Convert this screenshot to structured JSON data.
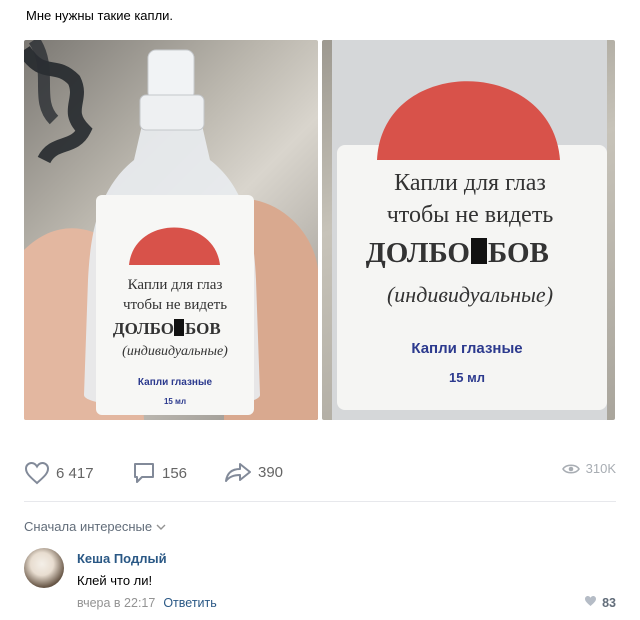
{
  "post": {
    "text": "Мне нужны такие капли.",
    "photos": [
      {
        "name": "photo-hand-bottle",
        "label": {
          "line1": "Капли для глаз",
          "line2": "чтобы не видеть",
          "line3a": "ДОЛБО",
          "line3b": "БОВ",
          "line4": "(индивидуальные)",
          "line5": "Капли глазные",
          "line6": "15 мл"
        }
      },
      {
        "name": "photo-label-closeup",
        "label": {
          "line1": "Капли для глаз",
          "line2": "чтобы не видеть",
          "line3a": "ДОЛБО",
          "line3b": "БОВ",
          "line4": "(индивидуальные)",
          "line5": "Капли глазные",
          "line6": "15 мл"
        }
      }
    ]
  },
  "actions": {
    "likes": "6 417",
    "comments": "156",
    "shares": "390",
    "views": "310K"
  },
  "comments": {
    "sort_label": "Сначала интересные",
    "items": [
      {
        "author": "Кеша Подлый",
        "text": "Клей что ли!",
        "time": "вчера в 22:17",
        "reply_label": "Ответить",
        "likes": "83"
      }
    ]
  },
  "colors": {
    "link": "#2a5885",
    "muted": "#656565",
    "label_red": "#d8524a"
  }
}
